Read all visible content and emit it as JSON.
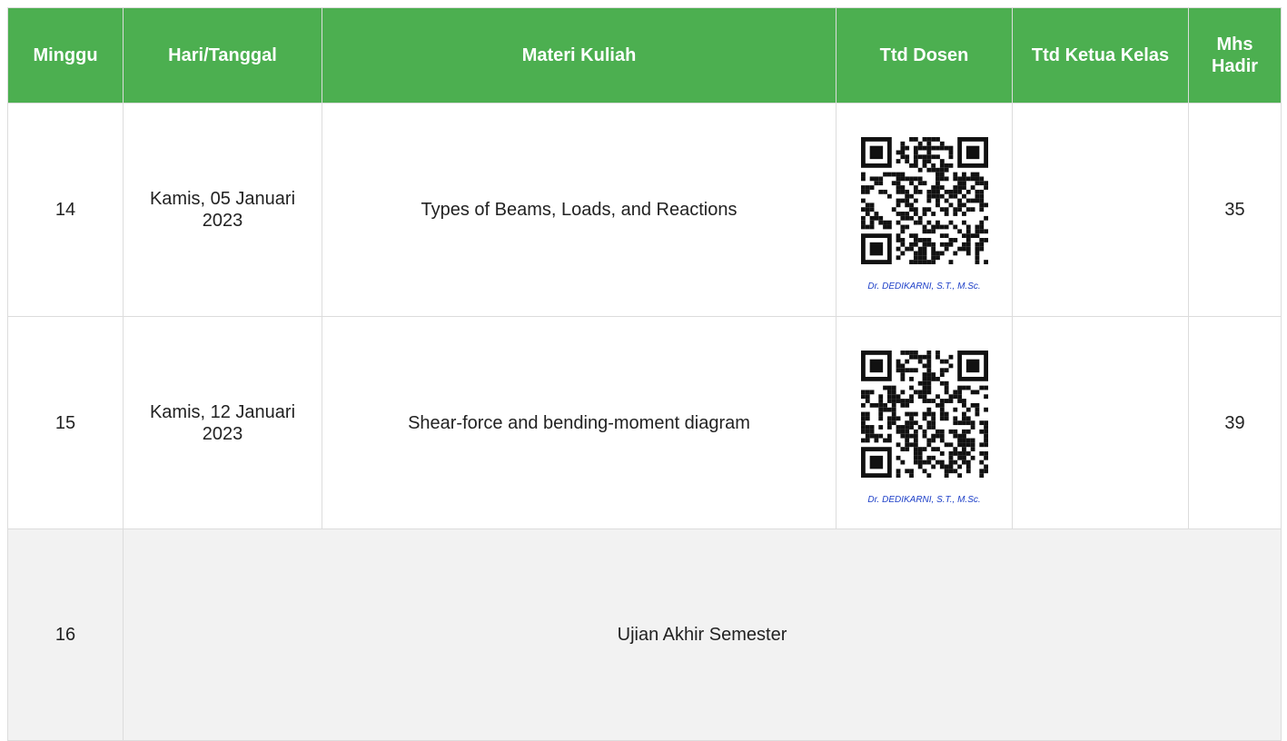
{
  "headers": {
    "minggu": "Minggu",
    "hari": "Hari/Tanggal",
    "materi": "Materi Kuliah",
    "ttd_dosen": "Ttd Dosen",
    "ttd_ketua": "Ttd Ketua Kelas",
    "mhs_hadir": "Mhs Hadir"
  },
  "rows": [
    {
      "minggu": "14",
      "hari": "Kamis, 05 Januari 2023",
      "materi": "Types of Beams, Loads, and Reactions",
      "dosen_signature": "Dr. DEDIKARNI, S.T., M.Sc.",
      "ttd_ketua": "",
      "mhs_hadir": "35",
      "qr_icon": "qr-code-icon"
    },
    {
      "minggu": "15",
      "hari": "Kamis, 12 Januari 2023",
      "materi": "Shear-force and bending-moment diagram",
      "dosen_signature": "Dr. DEDIKARNI, S.T., M.Sc.",
      "ttd_ketua": "",
      "mhs_hadir": "39",
      "qr_icon": "qr-code-icon"
    },
    {
      "minggu": "16",
      "note": "Ujian Akhir Semester"
    }
  ],
  "colors": {
    "header_bg": "#4caf50",
    "header_text": "#ffffff",
    "signature_text": "#1e40c8",
    "exam_row_bg": "#f2f2f2"
  }
}
